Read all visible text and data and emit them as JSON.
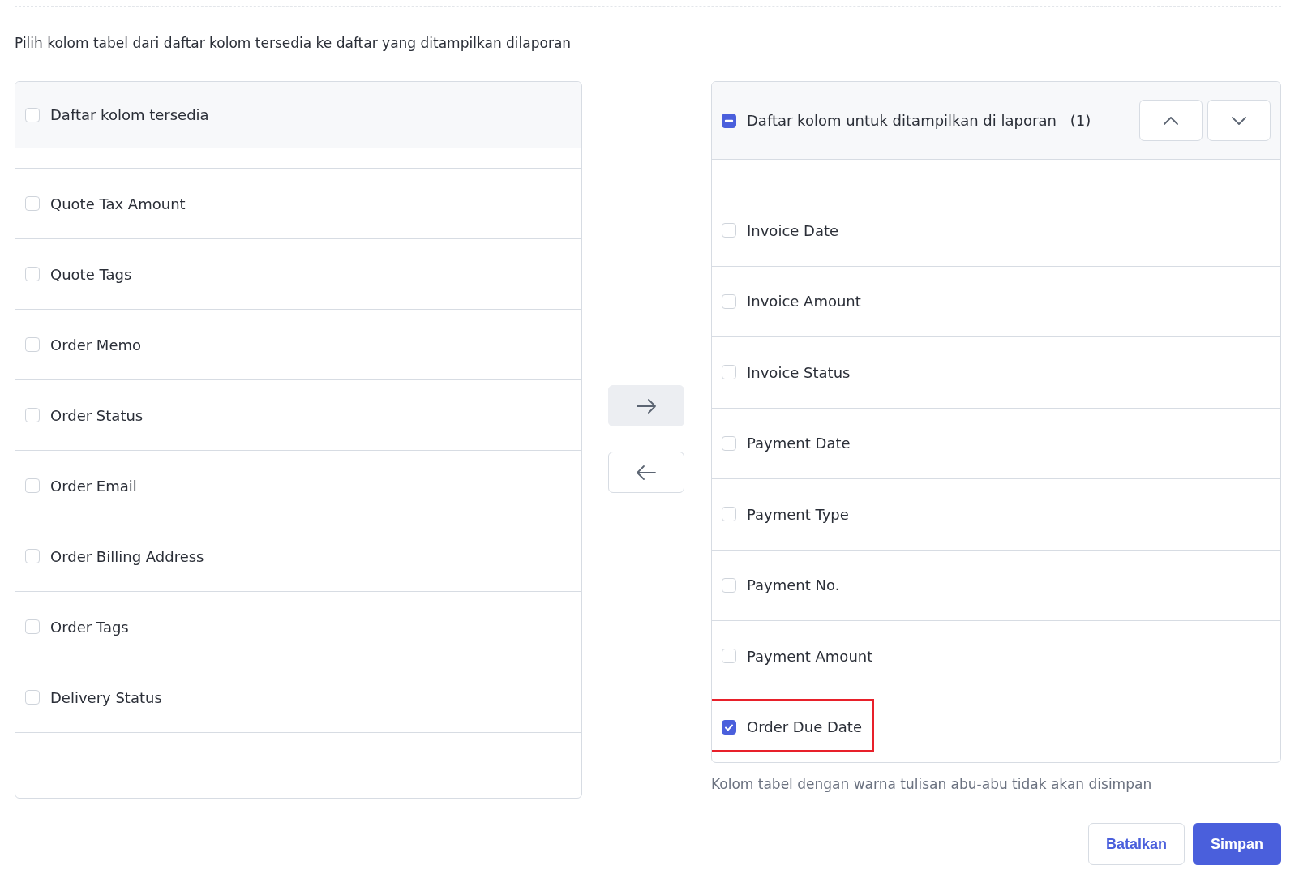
{
  "instruction": "Pilih kolom tabel dari daftar kolom tersedia ke daftar yang ditampilkan dilaporan",
  "available": {
    "header": {
      "label": "Daftar kolom tersedia",
      "checked": false,
      "indeterminate": false
    },
    "items": [
      {
        "label": "Quote Tax Amount",
        "checked": false
      },
      {
        "label": "Quote Tags",
        "checked": false
      },
      {
        "label": "Order Memo",
        "checked": false
      },
      {
        "label": "Order Status",
        "checked": false
      },
      {
        "label": "Order Email",
        "checked": false
      },
      {
        "label": "Order Billing Address",
        "checked": false
      },
      {
        "label": "Order Tags",
        "checked": false
      },
      {
        "label": "Delivery Status",
        "checked": false
      }
    ]
  },
  "transfer_buttons": [
    {
      "kind": "right",
      "disabled": true
    },
    {
      "kind": "left",
      "disabled": false
    }
  ],
  "selected_list": {
    "header": {
      "label": "Daftar kolom untuk ditampilkan di laporan",
      "count": "(1)",
      "indeterminate": true
    },
    "items": [
      {
        "label": "Invoice Date",
        "checked": false,
        "highlighted": false
      },
      {
        "label": "Invoice Amount",
        "checked": false,
        "highlighted": false
      },
      {
        "label": "Invoice Status",
        "checked": false,
        "highlighted": false
      },
      {
        "label": "Payment Date",
        "checked": false,
        "highlighted": false
      },
      {
        "label": "Payment Type",
        "checked": false,
        "highlighted": false
      },
      {
        "label": "Payment No.",
        "checked": false,
        "highlighted": false
      },
      {
        "label": "Payment Amount",
        "checked": false,
        "highlighted": false
      },
      {
        "label": "Order Due Date",
        "checked": true,
        "highlighted": true
      }
    ]
  },
  "note": "Kolom tabel dengan warna tulisan abu-abu tidak akan disimpan",
  "buttons": [
    {
      "label": "Batalkan",
      "kind": "secondary"
    },
    {
      "label": "Simpan",
      "kind": "primary"
    }
  ]
}
